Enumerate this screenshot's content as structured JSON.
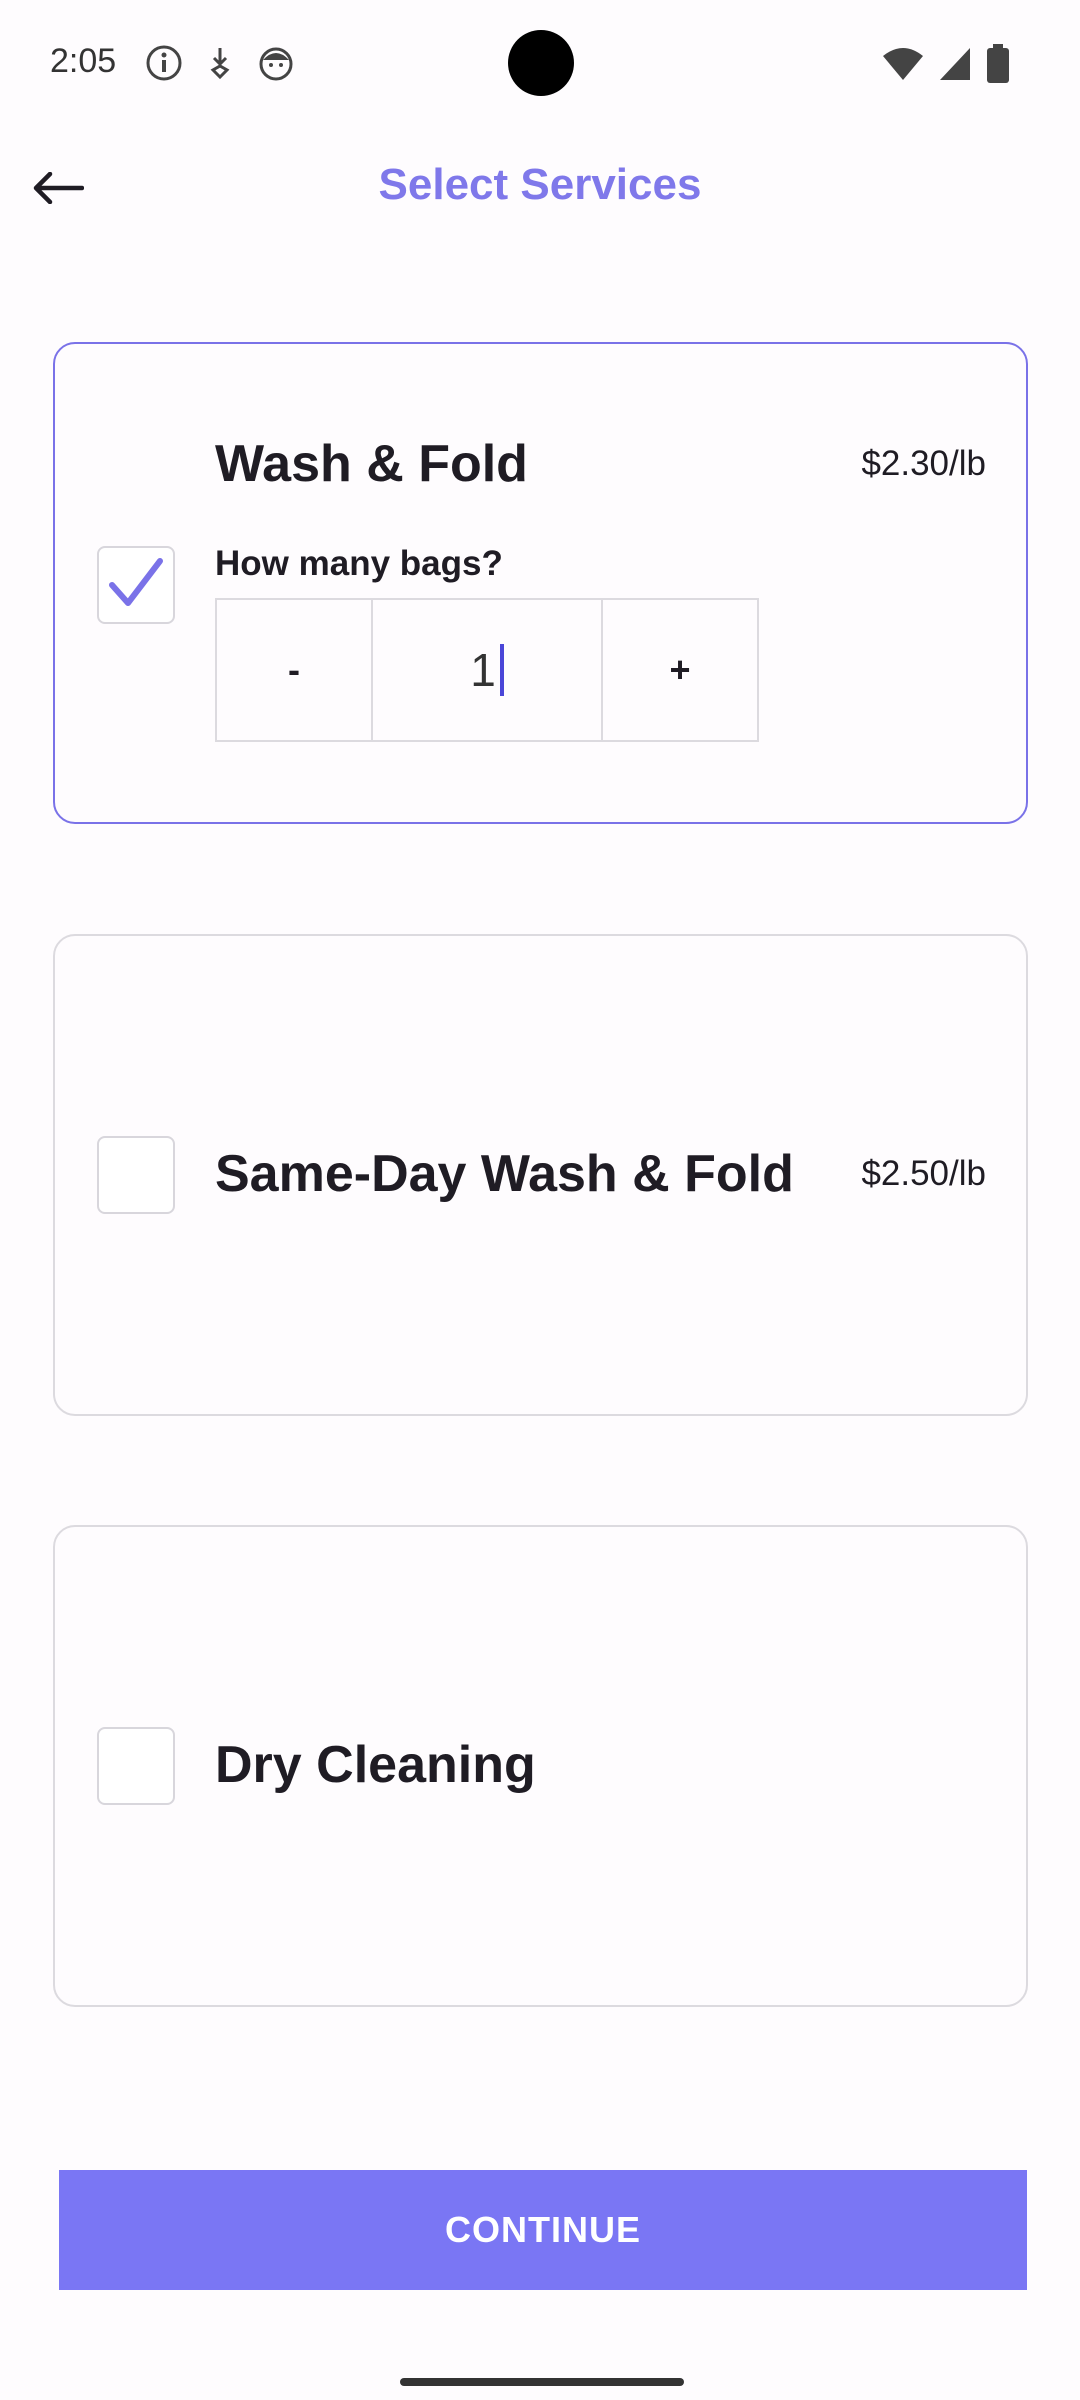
{
  "status_bar": {
    "time": "2:05",
    "left_icons": [
      "info-icon",
      "download-notification-icon",
      "face-icon"
    ],
    "right_icons": [
      "wifi-icon",
      "signal-icon",
      "battery-icon"
    ]
  },
  "header": {
    "title": "Select Services",
    "back_icon": "arrow-left-icon"
  },
  "services": [
    {
      "name": "Wash & Fold",
      "price": "$2.30/lb",
      "selected": true,
      "bags_label": "How many bags?",
      "decrement_label": "-",
      "quantity": "1",
      "increment_label": "+"
    },
    {
      "name": "Same-Day Wash & Fold",
      "price": "$2.50/lb",
      "selected": false
    },
    {
      "name": "Dry Cleaning",
      "price": "",
      "selected": false
    }
  ],
  "continue_label": "CONTINUE",
  "colors": {
    "accent": "#7a76f4",
    "title": "#7f78ea",
    "selected_border": "#7a72e8"
  }
}
